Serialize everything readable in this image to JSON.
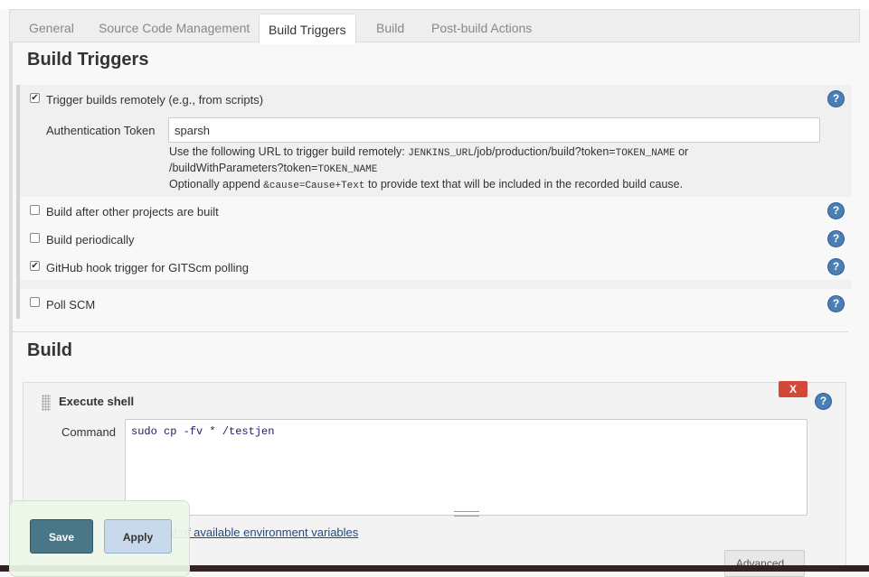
{
  "tabs": [
    {
      "label": "General"
    },
    {
      "label": "Source Code Management"
    },
    {
      "label": "Build Triggers",
      "active": true
    },
    {
      "label": "Build"
    },
    {
      "label": "Post-build Actions"
    }
  ],
  "build_triggers": {
    "title": "Build Triggers",
    "trigger_remote": {
      "label": "Trigger builds remotely (e.g., from scripts)",
      "checked": true,
      "auth_label": "Authentication Token",
      "auth_value": "sparsh",
      "desc_line1_pre": "Use the following URL to trigger build remotely: ",
      "desc_line1_code1": "JENKINS_URL",
      "desc_line1_mid": "/job/production/build?token=",
      "desc_line1_code2": "TOKEN_NAME",
      "desc_line1_post": " or",
      "desc_line2_pre": "/buildWithParameters?token=",
      "desc_line2_code": "TOKEN_NAME",
      "desc_line3_pre": "Optionally append ",
      "desc_line3_code": "&cause=Cause+Text",
      "desc_line3_post": " to provide text that will be included in the recorded build cause."
    },
    "after_other": {
      "label": "Build after other projects are built",
      "checked": false
    },
    "periodically": {
      "label": "Build periodically",
      "checked": false
    },
    "github_hook": {
      "label": "GitHub hook trigger for GITScm polling",
      "checked": true
    },
    "poll_scm": {
      "label": "Poll SCM",
      "checked": false
    }
  },
  "build": {
    "title": "Build",
    "execute_shell": {
      "title": "Execute shell",
      "delete_label": "X",
      "command_label": "Command",
      "command_value": "sudo cp -fv * /testjen",
      "env_link": "st of available environment variables",
      "advanced_label": "Advanced..."
    }
  },
  "help_glyph": "?",
  "check_glyph": "✔",
  "footer": {
    "save_label": "Save",
    "apply_label": "Apply"
  },
  "colors": {
    "delete": "#d24939",
    "save": "#4a7787",
    "apply": "#c7d9ea",
    "help": "#4a7fb5",
    "link": "#204a87"
  }
}
